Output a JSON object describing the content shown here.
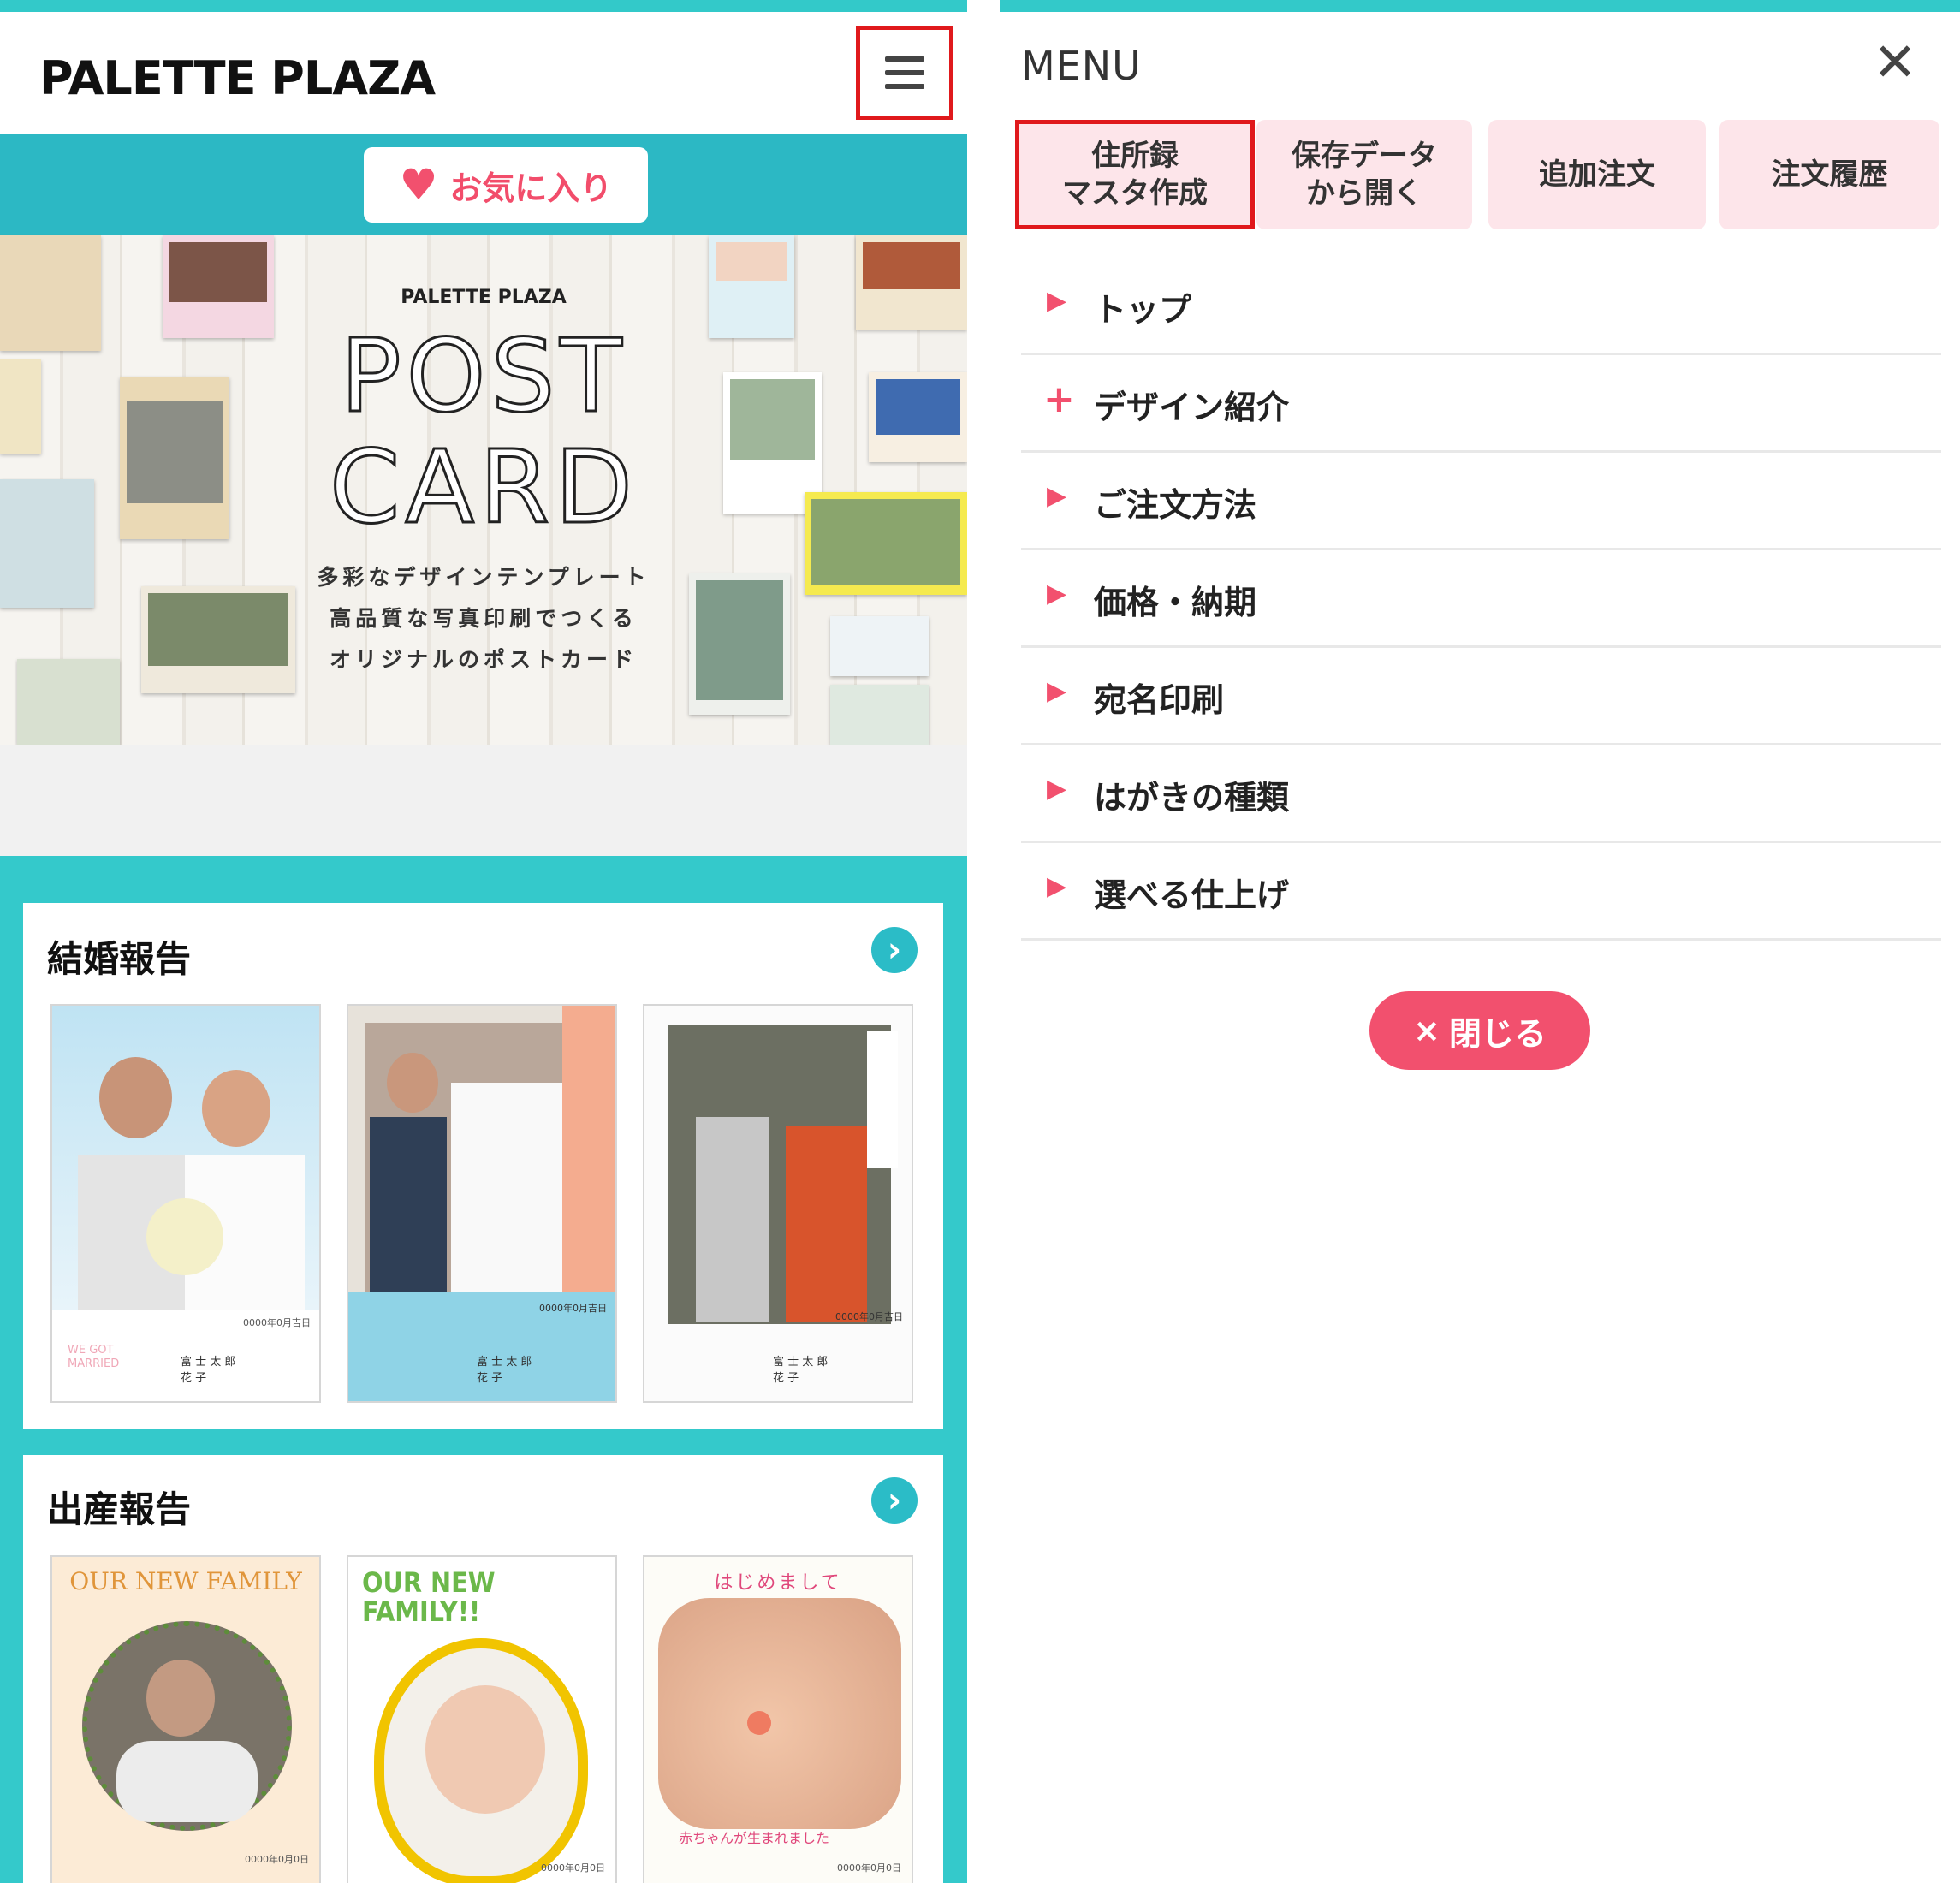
{
  "left": {
    "logo": "PALETTE PLAZA",
    "favorite_label": "お気に入り",
    "hero": {
      "brand": "PALETTE PLAZA",
      "line1": "POST",
      "line2": "CARD",
      "tagline": [
        "多彩なデザインテンプレート",
        "高品質な写真印刷でつくる",
        "オリジナルのポストカード"
      ]
    },
    "sections": [
      {
        "title": "結婚報告",
        "cards": [
          {
            "date": "0000年0月吉日",
            "corner": "WE GOT MARRIED",
            "names": "富 士 太 郎\n花 子"
          },
          {
            "date": "0000年0月吉日",
            "corner": "",
            "names": "富 士 太 郎\n花 子"
          },
          {
            "date": "0000年0月吉日",
            "corner": "",
            "names": "富 士 太 郎\n花 子"
          }
        ]
      },
      {
        "title": "出産報告",
        "cards": [
          {
            "heading": "OUR NEW FAMILY",
            "date": "0000年0月0日"
          },
          {
            "heading": "OUR NEW FAMILY!!",
            "date": "0000年0月0日"
          },
          {
            "heading": "はじめまして",
            "caption": "赤ちゃんが生まれました",
            "date": "0000年0月0日"
          }
        ]
      }
    ]
  },
  "right": {
    "title": "MENU",
    "quick_buttons": [
      "住所録\nマスタ作成",
      "保存データ\nから開く",
      "追加注文",
      "注文履歴"
    ],
    "items": [
      {
        "label": "トップ",
        "marker": "▶"
      },
      {
        "label": "デザイン紹介",
        "marker": "+"
      },
      {
        "label": "ご注文方法",
        "marker": "▶"
      },
      {
        "label": "価格・納期",
        "marker": "▶"
      },
      {
        "label": "宛名印刷",
        "marker": "▶"
      },
      {
        "label": "はがきの種類",
        "marker": "▶"
      },
      {
        "label": "選べる仕上げ",
        "marker": "▶"
      }
    ],
    "close_label": "閉じる",
    "close_icon": "×"
  },
  "colors": {
    "teal": "#34c9cb",
    "pink": "#f2506e",
    "pink_light": "#fde5ea",
    "highlight": "#e0191c"
  }
}
